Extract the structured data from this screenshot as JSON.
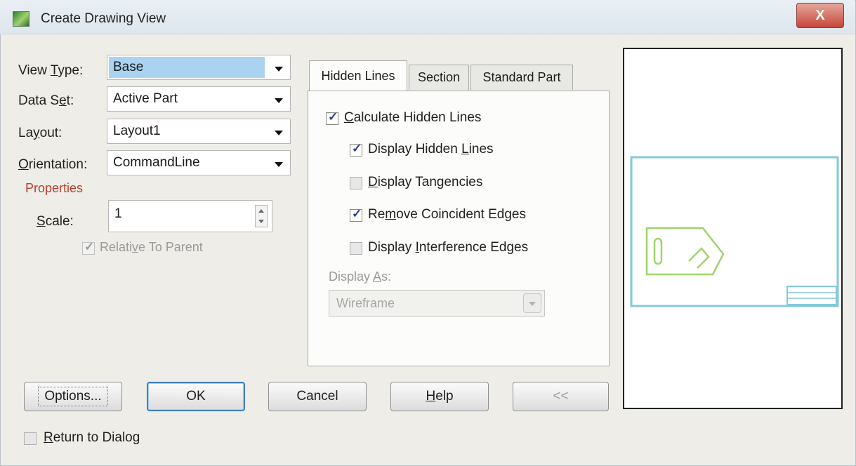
{
  "window": {
    "title": "Create Drawing View",
    "close_label": "X"
  },
  "left": {
    "view_type": {
      "label": "View Type:",
      "value": "Base"
    },
    "data_set": {
      "label": "Data Set:",
      "value": "Active Part"
    },
    "layout": {
      "label": "Layout:",
      "value": "Layout1"
    },
    "orientation": {
      "label": "Orientation:",
      "value": "CommandLine"
    },
    "properties_title": "Properties",
    "scale": {
      "label": "Scale:",
      "value": "1"
    },
    "relative_to_parent": {
      "label": "Relative To Parent",
      "checked": true,
      "enabled": false
    }
  },
  "tabs": [
    {
      "label": "Hidden Lines",
      "active": true
    },
    {
      "label": "Section",
      "active": false
    },
    {
      "label": "Standard Part",
      "active": false
    }
  ],
  "hidden_lines": {
    "calculate": {
      "label": "Calculate Hidden Lines",
      "checked": true
    },
    "display_hidden": {
      "label": "Display Hidden Lines",
      "checked": true
    },
    "display_tangencies": {
      "label": "Display Tangencies",
      "checked": false
    },
    "remove_coincident": {
      "label": "Remove Coincident Edges",
      "checked": true
    },
    "display_interference": {
      "label": "Display Interference Edges",
      "checked": false
    },
    "display_as": {
      "label": "Display As:",
      "value": "Wireframe",
      "enabled": false
    }
  },
  "buttons": {
    "options": "Options...",
    "ok": "OK",
    "cancel": "Cancel",
    "help": "Help",
    "collapse": "<<"
  },
  "return_to_dialog": {
    "label": "Return to Dialog",
    "checked": false
  },
  "colors": {
    "preview_frame": "#83c9d9",
    "preview_part": "#9fd36a",
    "properties_title": "#b5402c",
    "ok_border": "#3d7fc6"
  }
}
